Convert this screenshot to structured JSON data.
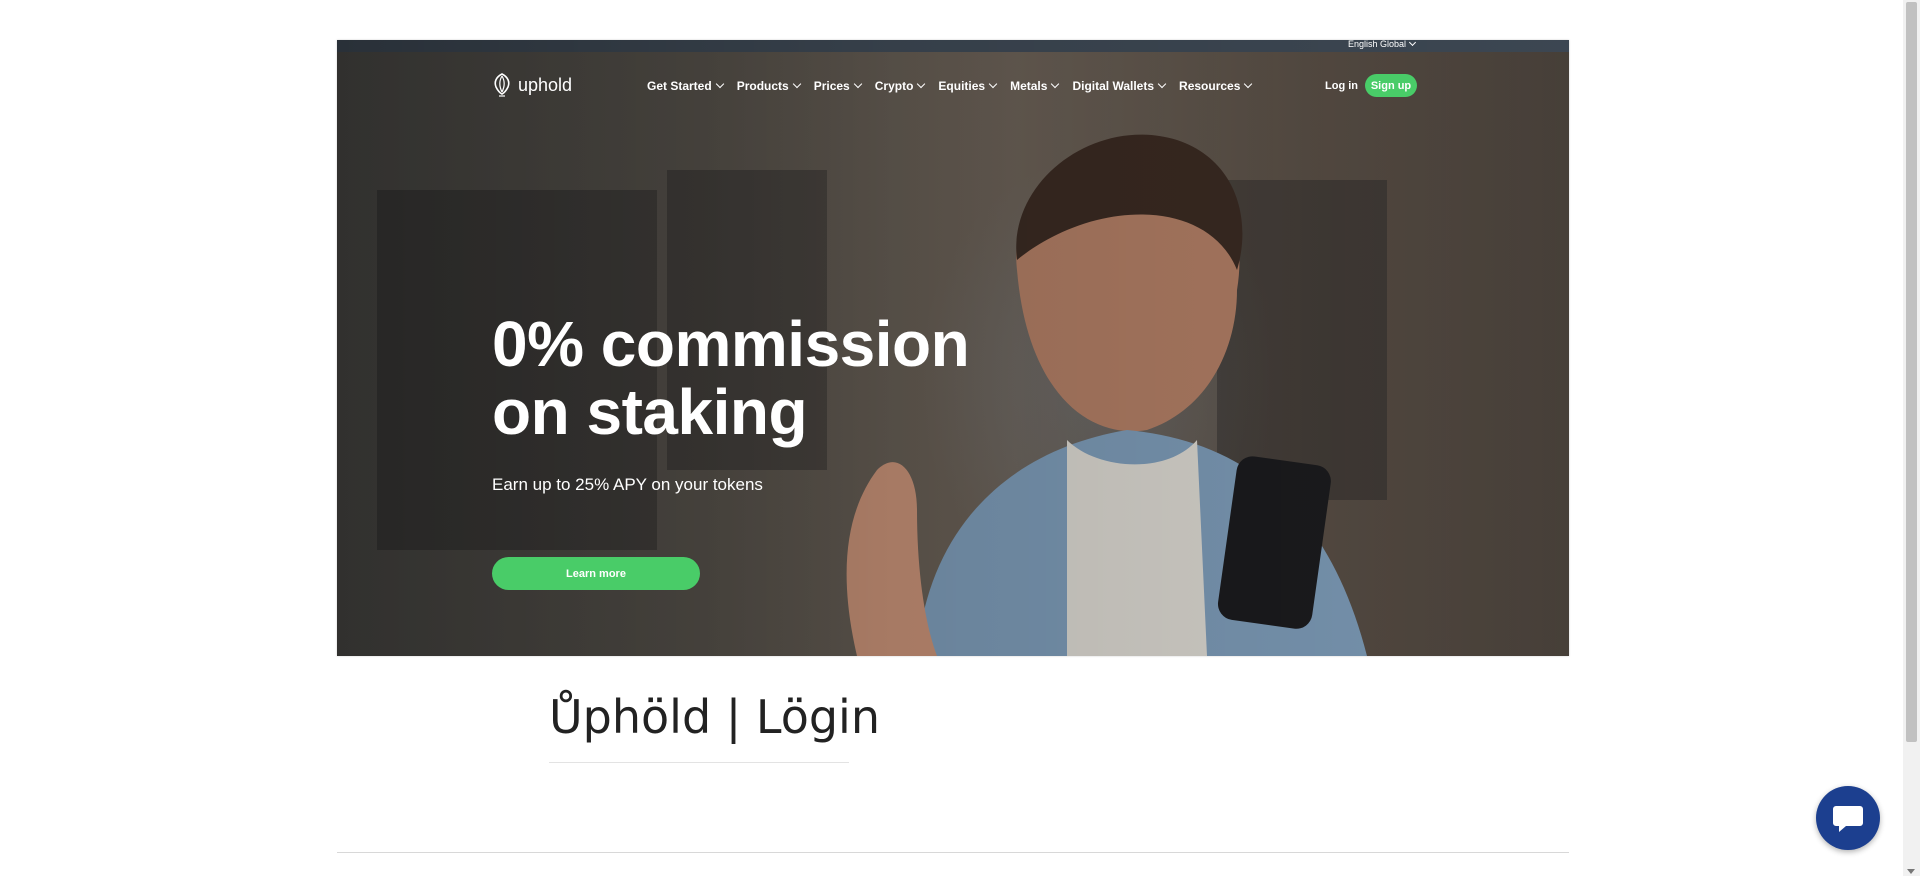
{
  "header": {
    "language": "English Global",
    "logo_text": "uphold",
    "nav": [
      {
        "label": "Get Started"
      },
      {
        "label": "Products"
      },
      {
        "label": "Prices"
      },
      {
        "label": "Crypto"
      },
      {
        "label": "Equities"
      },
      {
        "label": "Metals"
      },
      {
        "label": "Digital Wallets"
      },
      {
        "label": "Resources"
      }
    ],
    "login_label": "Log in",
    "signup_label": "Sign up"
  },
  "hero": {
    "headline_line1": "0% commission",
    "headline_line2": "on staking",
    "subheadline": "Earn up to 25% APY on your tokens",
    "cta_label": "Learn more"
  },
  "page": {
    "title": "Ůphöld | Lögin"
  },
  "colors": {
    "accent_green": "#49cc68",
    "chat_blue": "#1c3f8f"
  },
  "icons": {
    "logo": "uphold-logo-icon",
    "chat": "chat-bubble-icon"
  }
}
